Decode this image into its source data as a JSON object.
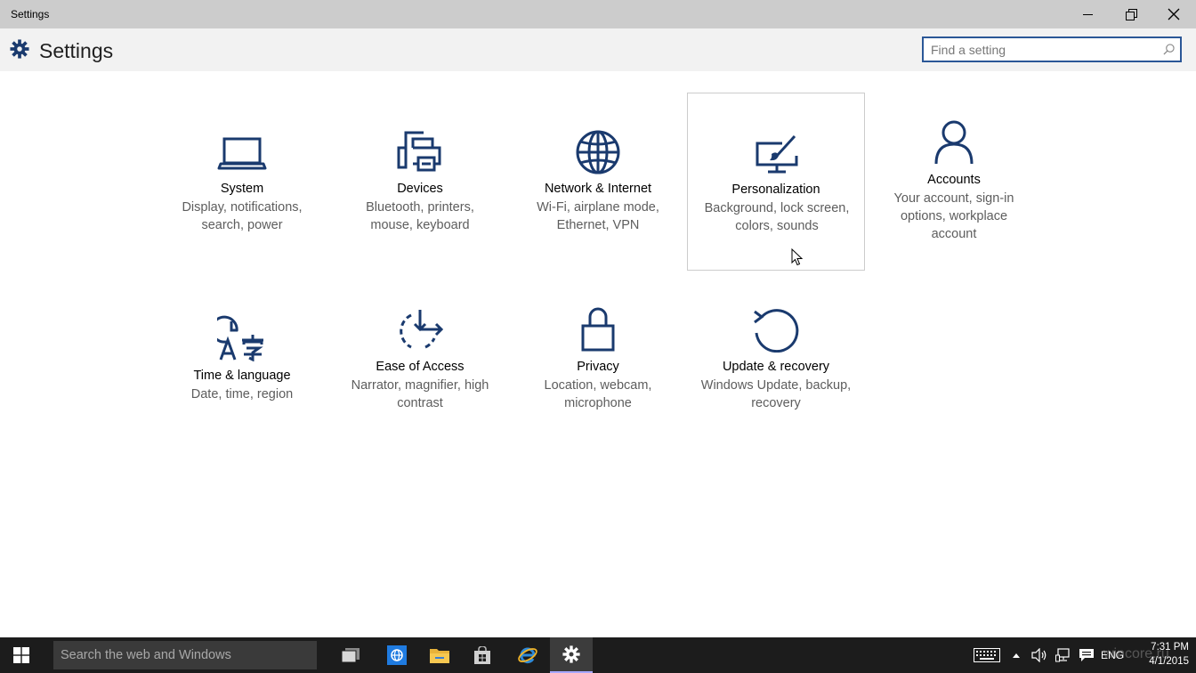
{
  "window": {
    "title": "Settings"
  },
  "header": {
    "title": "Settings"
  },
  "search": {
    "placeholder": "Find a setting"
  },
  "tiles": [
    {
      "name": "System",
      "desc": "Display, notifications, search, power",
      "icon": "laptop-icon"
    },
    {
      "name": "Devices",
      "desc": "Bluetooth, printers, mouse, keyboard",
      "icon": "printer-icon"
    },
    {
      "name": "Network & Internet",
      "desc": "Wi-Fi, airplane mode, Ethernet, VPN",
      "icon": "globe-icon"
    },
    {
      "name": "Personalization",
      "desc": "Background, lock screen, colors, sounds",
      "icon": "paintbrush-monitor-icon"
    },
    {
      "name": "Accounts",
      "desc": "Your account, sign-in options, workplace account",
      "icon": "person-icon"
    },
    {
      "name": "Time & language",
      "desc": "Date, time, region",
      "icon": "clock-language-icon"
    },
    {
      "name": "Ease of Access",
      "desc": "Narrator, magnifier, high contrast",
      "icon": "ease-of-access-icon"
    },
    {
      "name": "Privacy",
      "desc": "Location, webcam, microphone",
      "icon": "lock-icon"
    },
    {
      "name": "Update & recovery",
      "desc": "Windows Update, backup, recovery",
      "icon": "refresh-icon"
    }
  ],
  "taskbar": {
    "search_placeholder": "Search the web and Windows",
    "language": "ENG",
    "time": "7:31 PM",
    "date": "4/1/2015",
    "watermark": "wincore.ru"
  },
  "colors": {
    "accent": "#1a3a6e",
    "titlebar": "#cccccc",
    "header": "#f2f2f2",
    "taskbar": "#1c1c1c"
  }
}
